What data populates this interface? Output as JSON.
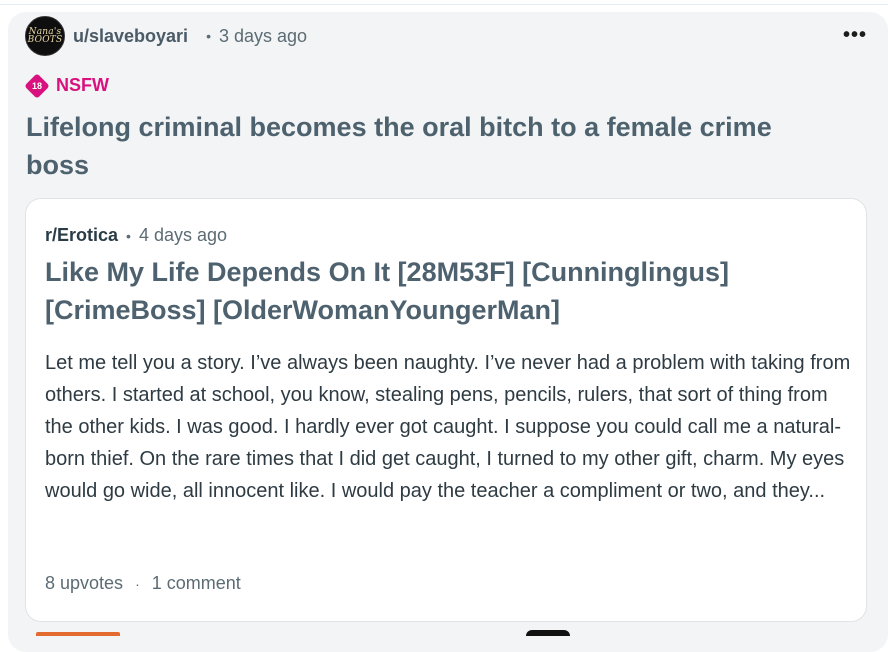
{
  "post": {
    "username": "u/slaveboyari",
    "separator": "•",
    "time": "3 days ago",
    "more_label": "•••",
    "nsfw_badge": "18",
    "nsfw_label": "NSFW",
    "title": "Lifelong criminal becomes the oral bitch to a female crime boss"
  },
  "avatar": {
    "logo_text": "Nana's BOOTS"
  },
  "crosspost": {
    "subreddit": "r/Erotica",
    "separator": "•",
    "time": "4 days ago",
    "title": "Like My Life Depends On It [28M53F] [Cunninglingus] [CrimeBoss] [OlderWomanYoungerMan]",
    "body": "Let me tell you a story. I’ve always been naughty. I’ve never had a problem with taking from others. I started at school, you know, stealing pens, pencils, rulers, that sort of thing from the other kids. I was good. I hardly ever got caught. I suppose you could call me a natural-born thief. On the rare times that I did get caught, I turned to my other gift, charm. My eyes would go wide, all innocent like. I would pay the teacher a compliment or two, and they...",
    "upvotes": "8 upvotes",
    "stats_separator": "·",
    "comments": "1 comment"
  },
  "colors": {
    "nsfw": "#d9117e",
    "title": "#4d626e",
    "card_bg": "#f2f4f5"
  }
}
